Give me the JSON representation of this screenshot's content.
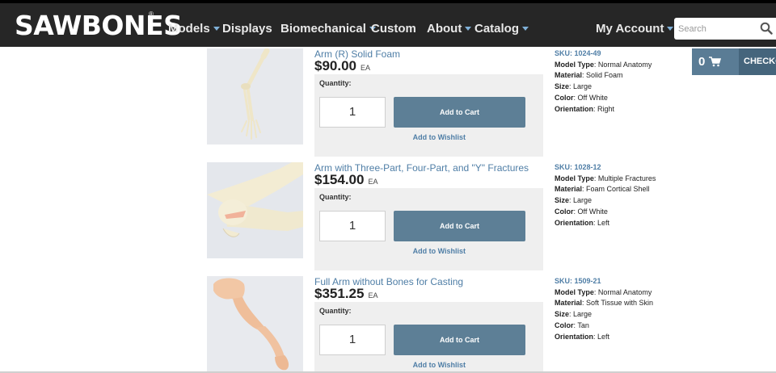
{
  "header": {
    "logo_text": "SAWBONES",
    "logo_reg": "®",
    "nav": [
      {
        "label": "Models",
        "dropdown": true
      },
      {
        "label": "Displays",
        "dropdown": false
      },
      {
        "label": "Biomechanical",
        "dropdown": true
      },
      {
        "label": "Custom",
        "dropdown": false
      },
      {
        "label": "About",
        "dropdown": true
      },
      {
        "label": "Catalog",
        "dropdown": true
      }
    ],
    "account_label": "My Account",
    "search_placeholder": "Search"
  },
  "cart": {
    "count": "0",
    "checkout_label": "CHECKOUT"
  },
  "colors": {
    "header_bg": "#262626",
    "link": "#4f7ea6",
    "button": "#5d7f96",
    "cart_bg": "#5a7c95"
  },
  "labels": {
    "quantity": "Quantity:",
    "add_to_cart": "Add to Cart",
    "add_to_wishlist": "Add to Wishlist",
    "unit": "EA",
    "sku_prefix": "SKU: ",
    "model_type": "Model Type",
    "material": "Material",
    "size": "Size",
    "color": "Color",
    "orientation": "Orientation"
  },
  "products": [
    {
      "title": "Arm (R) Solid Foam",
      "price": "$90.00",
      "quantity": "1",
      "sku": "1024-49",
      "model_type": "Normal Anatomy",
      "material": "Solid Foam",
      "size": "Large",
      "color": "Off White",
      "orientation": "Right"
    },
    {
      "title": "Arm with Three-Part, Four-Part, and \"Y\" Fractures",
      "price": "$154.00",
      "quantity": "1",
      "sku": "1028-12",
      "model_type": "Multiple Fractures",
      "material": "Foam Cortical Shell",
      "size": "Large",
      "color": "Off White",
      "orientation": "Left"
    },
    {
      "title": "Full Arm without Bones for Casting",
      "price": "$351.25",
      "quantity": "1",
      "sku": "1509-21",
      "model_type": "Normal Anatomy",
      "material": "Soft Tissue with Skin",
      "size": "Large",
      "color": "Tan",
      "orientation": "Left"
    }
  ]
}
